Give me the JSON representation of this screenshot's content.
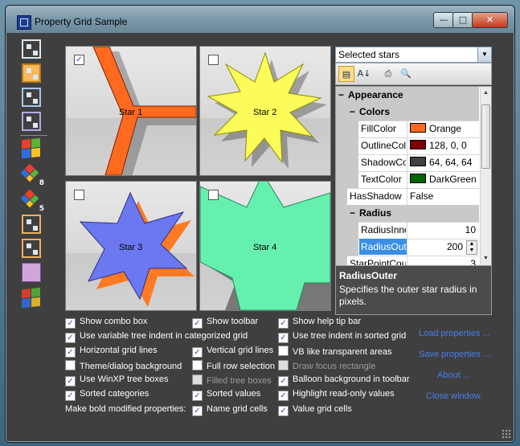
{
  "window": {
    "title": "Property Grid Sample"
  },
  "caption": {
    "min": "—",
    "max": "□",
    "close": "✕"
  },
  "sidebar": {
    "items": [
      {
        "icon": "grid-icon",
        "style": "default"
      },
      {
        "icon": "grid-icon",
        "style": "selected"
      },
      {
        "icon": "grid-icon",
        "style": "blue"
      },
      {
        "icon": "grid-icon",
        "style": "purple"
      },
      {
        "icon": "windows-flag-icon"
      },
      {
        "icon": "windows-flag-icon",
        "badge": "8"
      },
      {
        "icon": "windows-flag-icon",
        "badge": "5"
      },
      {
        "icon": "grid-icon",
        "style": "default"
      },
      {
        "icon": "grid-icon",
        "style": "default"
      },
      {
        "icon": "puzzle-icon"
      },
      {
        "icon": "windows-flag-icon"
      }
    ]
  },
  "stars": [
    {
      "label": "Star 1",
      "checked": true,
      "fill": "#ff6a1f",
      "outline": "#8b1a00"
    },
    {
      "label": "Star 2",
      "checked": false,
      "fill": "#fbfb5a",
      "outline": "#8b8b00"
    },
    {
      "label": "Star 3",
      "checked": false,
      "fill": "#6c78f0",
      "outline": "#2a2f8a"
    },
    {
      "label": "Star 4",
      "checked": false,
      "fill": "#66f0b0",
      "outline": "#1f8a5a"
    }
  ],
  "combo": {
    "value": "Selected stars"
  },
  "toolbar": {
    "icons": [
      "categorized-icon",
      "alphabetic-icon",
      "print-icon",
      "preview-icon"
    ]
  },
  "grid": {
    "rows": [
      {
        "kind": "cat",
        "name": "Appearance"
      },
      {
        "kind": "subcat",
        "name": "Colors"
      },
      {
        "kind": "prop",
        "name": "FillColor",
        "value": "Orange",
        "swatch": "#ff6a1f"
      },
      {
        "kind": "prop",
        "name": "OutlineColor",
        "value": "128, 0, 0",
        "swatch": "#800000"
      },
      {
        "kind": "prop",
        "name": "ShadowColor",
        "value": "64, 64, 64",
        "swatch": "#404040"
      },
      {
        "kind": "prop",
        "name": "TextColor",
        "value": "DarkGreen",
        "swatch": "#006400"
      },
      {
        "kind": "prop-flat",
        "name": "HasShadow",
        "value": "False"
      },
      {
        "kind": "subcat",
        "name": "Radius"
      },
      {
        "kind": "prop",
        "name": "RadiusInner",
        "value": "10"
      },
      {
        "kind": "prop-sel",
        "name": "RadiusOuter",
        "value": "200"
      },
      {
        "kind": "prop",
        "name": "StarPointCount",
        "value": "3"
      }
    ]
  },
  "help": {
    "title": "RadiusOuter",
    "description": "Specifies the outer star radius in pixels."
  },
  "options": [
    {
      "label": "Show combo box",
      "checked": true
    },
    {
      "label": "Use variable tree indent in categorized grid",
      "checked": true
    },
    {
      "label": "Horizontal grid lines",
      "checked": true
    },
    {
      "label": "Theme/dialog background",
      "checked": false
    },
    {
      "label": "Use WinXP tree boxes",
      "checked": true
    },
    {
      "label": "Sorted categories",
      "checked": true
    },
    {
      "label": "Show toolbar",
      "checked": true
    },
    {
      "label": "Vertical grid lines",
      "checked": true
    },
    {
      "label": "Full row selection",
      "checked": false
    },
    {
      "label": "Filled tree boxes",
      "checked": false,
      "disabled": true
    },
    {
      "label": "Sorted values",
      "checked": true
    },
    {
      "label": "Name grid cells",
      "checked": true
    },
    {
      "label": "Show help tip bar",
      "checked": true
    },
    {
      "label": "Use tree indent in sorted grid",
      "checked": true
    },
    {
      "label": "VB like transparent areas",
      "checked": false
    },
    {
      "label": "Draw focus rectangle",
      "checked": false,
      "disabled": true
    },
    {
      "label": "Balloon background in toolbar",
      "checked": true
    },
    {
      "label": "Highlight read-only values",
      "checked": true
    },
    {
      "label": "Value grid cells",
      "checked": true
    }
  ],
  "bold_label": "Make bold modified properties:",
  "links": {
    "load": "Load properties ...",
    "save": "Save properties ...",
    "about": "About ...",
    "close": "Close window"
  }
}
